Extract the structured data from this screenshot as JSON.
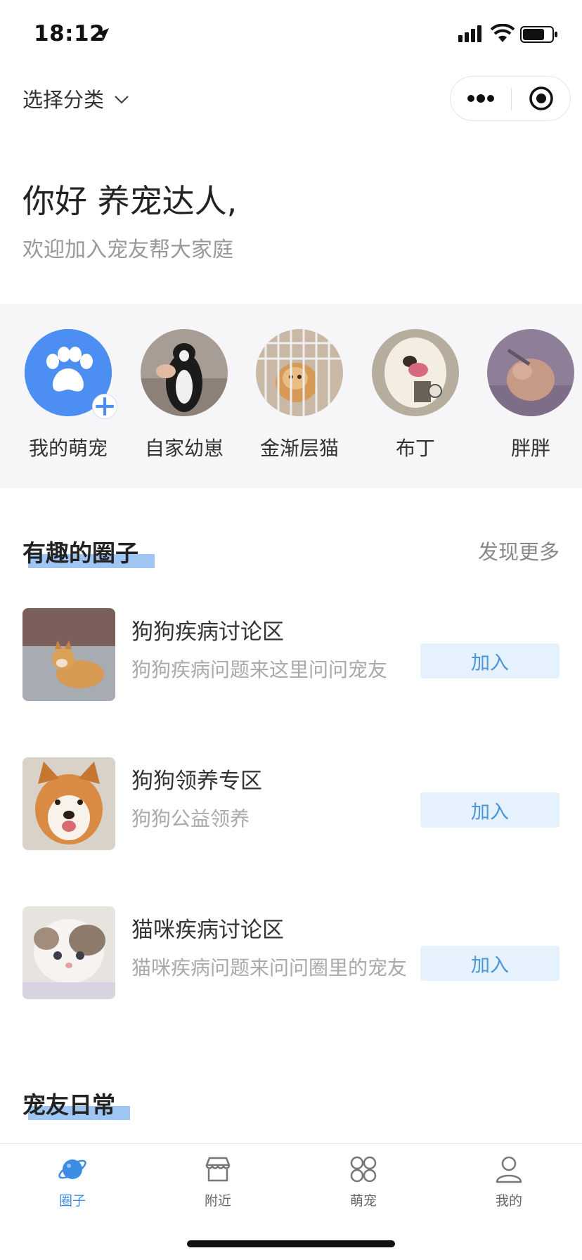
{
  "status_bar": {
    "time": "18:12"
  },
  "header": {
    "category_label": "选择分类"
  },
  "greeting": {
    "title": "你好 养宠达人,",
    "subtitle": "欢迎加入宠友帮大家庭"
  },
  "pets": [
    {
      "name": "我的萌宠",
      "avatar": "paw-icon"
    },
    {
      "name": "自家幼崽"
    },
    {
      "name": "金渐层猫"
    },
    {
      "name": "布丁"
    },
    {
      "name": "胖胖"
    }
  ],
  "circles_section": {
    "title": "有趣的圈子",
    "more_label": "发现更多"
  },
  "circles": [
    {
      "name": "狗狗疾病讨论区",
      "desc": "狗狗疾病问题来这里问问宠友",
      "join_label": "加入"
    },
    {
      "name": "狗狗领养专区",
      "desc": "狗狗公益领养",
      "join_label": "加入"
    },
    {
      "name": "猫咪疾病讨论区",
      "desc": "猫咪疾病问题来问问圈里的宠友",
      "join_label": "加入"
    }
  ],
  "daily_section": {
    "title": "宠友日常"
  },
  "tabbar": [
    {
      "label": "圈子",
      "icon": "planet-icon",
      "active": true
    },
    {
      "label": "附近",
      "icon": "store-icon"
    },
    {
      "label": "萌宠",
      "icon": "grid-icon"
    },
    {
      "label": "我的",
      "icon": "user-icon"
    }
  ],
  "colors": {
    "accent": "#3d8de6",
    "join_bg": "#e5f1fc",
    "underline": "#9fc6f3",
    "strip_bg": "#f6f6f9"
  }
}
